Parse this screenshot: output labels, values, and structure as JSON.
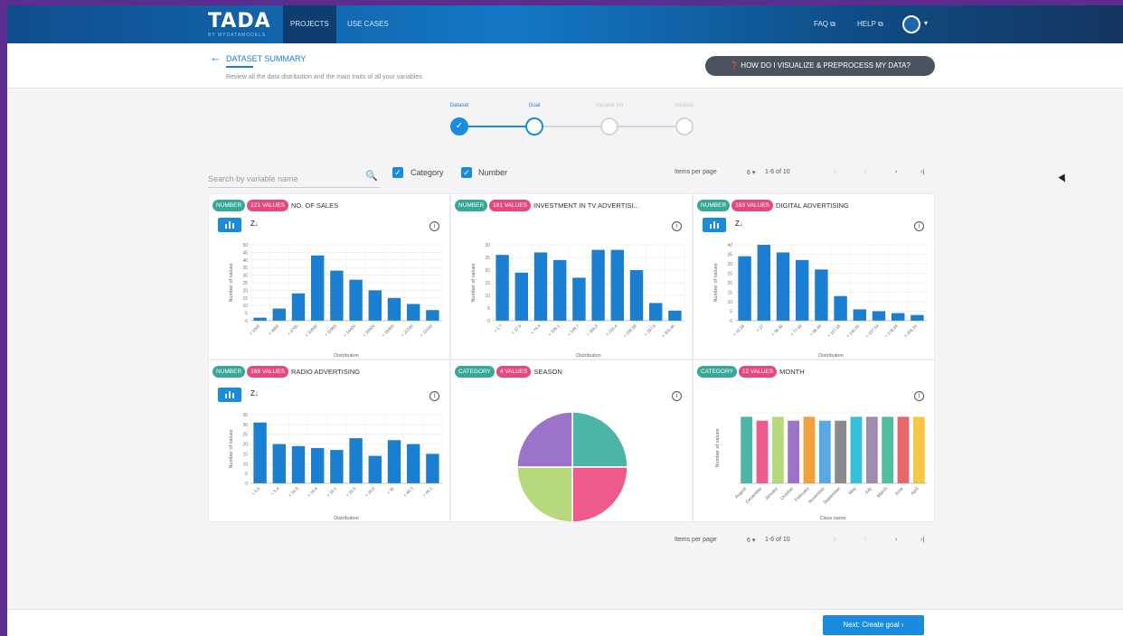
{
  "nav": {
    "logo": "TADA",
    "logo_sub": "BY MYDATAMODELS",
    "tabs": [
      {
        "label": "PROJECTS"
      },
      {
        "label": "USE CASES"
      }
    ],
    "faq": "FAQ ⧉",
    "help": "HELP ⧉"
  },
  "header": {
    "title": "DATASET SUMMARY",
    "subtitle": "Review all the data distribution and the main traits of all your variables",
    "help_button": "HOW DO I VISUALIZE & PREPROCESS MY DATA?"
  },
  "stepper": {
    "steps": [
      {
        "label": "Dataset",
        "state": "done"
      },
      {
        "label": "Goal",
        "state": "active"
      },
      {
        "label": "Variable list",
        "state": "pending"
      },
      {
        "label": "Validate",
        "state": "pending"
      }
    ]
  },
  "controls": {
    "search_placeholder": "Search by variable name",
    "filters": [
      {
        "label": "Category",
        "checked": true
      },
      {
        "label": "Number",
        "checked": true
      }
    ],
    "pagination_top": {
      "items_per_page": "Items per page",
      "per_page_value": "6",
      "range": "1-6 of 10"
    },
    "pagination_bottom": {
      "items_per_page": "Items per page",
      "per_page_value": "6",
      "range": "1-6 of 10"
    }
  },
  "cards": [
    {
      "type": "NUMBER",
      "count": "121 VALUES",
      "title": "NO. OF SALES"
    },
    {
      "type": "NUMBER",
      "count": "191 VALUES",
      "title": "INVESTMENT IN TV ADVERTISI..."
    },
    {
      "type": "NUMBER",
      "count": "183 VALUES",
      "title": "DIGITAL ADVERTISING"
    },
    {
      "type": "NUMBER",
      "count": "168 VALUES",
      "title": "RADIO ADVERTISING"
    },
    {
      "type": "CATEGORY",
      "count": "4 VALUES",
      "title": "SEASON"
    },
    {
      "type": "CATEGORY",
      "count": "12 VALUES",
      "title": "MONTH"
    }
  ],
  "chart_data": [
    {
      "type": "bar",
      "xlabel": "Distribution",
      "ylabel": "Number of values",
      "ylim": [
        0,
        50
      ],
      "yticks": [
        0,
        5,
        10,
        15,
        20,
        25,
        30,
        35,
        40,
        45,
        50
      ],
      "categories": [
        "< 1600",
        "< 4800",
        "< 8700",
        "< 10600",
        "< 11900",
        "< 14400",
        "< 16800",
        "< 19400",
        "< 22100",
        "> 22100"
      ],
      "values": [
        2,
        8,
        18,
        43,
        33,
        27,
        20,
        15,
        11,
        7
      ],
      "color": "#1a7fd0"
    },
    {
      "type": "bar",
      "xlabel": "Distribution",
      "ylabel": "Number of values",
      "ylim": [
        0,
        30
      ],
      "yticks": [
        0,
        5,
        10,
        15,
        20,
        25,
        30
      ],
      "categories": [
        "< 1.7",
        "< 37.9",
        "< 74.4",
        "< 109.1",
        "< 148.7",
        "< 186.9",
        "< 216.4",
        "< 255.08",
        "< 287.8",
        "> 303.45"
      ],
      "values": [
        26,
        19,
        27,
        24,
        17,
        28,
        28,
        20,
        7,
        4
      ],
      "color": "#1a7fd0"
    },
    {
      "type": "bar",
      "xlabel": "Distribution",
      "ylabel": "Number of values",
      "ylim": [
        0,
        40
      ],
      "yticks": [
        0,
        5,
        10,
        15,
        20,
        25,
        30,
        35,
        40
      ],
      "categories": [
        "< 15.08",
        "< 27",
        "< 38.39",
        "< 77.09",
        "< 88.48",
        "< 117.18",
        "< 140.55",
        "< 157.54",
        "< 178.04",
        "> 208.16"
      ],
      "values": [
        34,
        40,
        36,
        32,
        27,
        13,
        6,
        5,
        4,
        3
      ],
      "color": "#1a7fd0"
    },
    {
      "type": "bar",
      "xlabel": "Distribution",
      "ylabel": "Number of values",
      "ylim": [
        0,
        35
      ],
      "yticks": [
        0,
        5,
        10,
        15,
        20,
        25,
        30,
        35
      ],
      "categories": [
        "< 6.5",
        "< 5.4",
        "< 10.8",
        "< 15.4",
        "< 20.1",
        "< 25.5",
        "< 29.8",
        "< 35",
        "< 40.3",
        "> 45.1"
      ],
      "values": [
        31,
        20,
        19,
        18,
        17,
        23,
        14,
        22,
        20,
        15
      ],
      "color": "#1a7fd0"
    },
    {
      "type": "pie",
      "values": [
        25,
        25,
        25,
        25
      ],
      "colors": [
        "#4bb5a8",
        "#ef5a8d",
        "#b6d97c",
        "#9b73c9"
      ]
    },
    {
      "type": "bar",
      "xlabel": "Class name",
      "ylabel": "Number of values",
      "categories": [
        "August",
        "December",
        "January",
        "October",
        "February",
        "November",
        "September",
        "May",
        "July",
        "March",
        "June",
        "April"
      ],
      "values": [
        17,
        16,
        17,
        16,
        17,
        16,
        16,
        17,
        17,
        17,
        17,
        17
      ],
      "ylim": [
        0,
        18
      ],
      "colors": [
        "#4bb5a8",
        "#ef5a8d",
        "#b6d97c",
        "#9b73c9",
        "#f0a23c",
        "#5aa7e6",
        "#8a8a8a",
        "#34c0d8",
        "#9f8bb0",
        "#4fbfa0",
        "#e8676b",
        "#f6c744"
      ]
    }
  ],
  "footer": {
    "next_button": "Next: Create goal ›"
  }
}
